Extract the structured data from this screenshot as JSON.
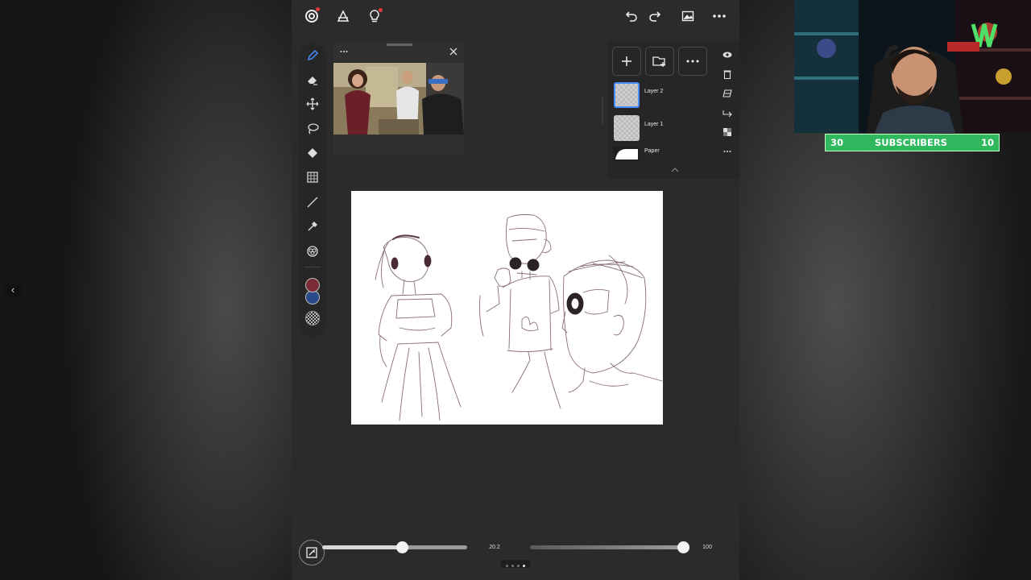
{
  "layers_panel": {
    "layers": [
      {
        "name": "Layer 2",
        "selected": true
      },
      {
        "name": "Layer 1",
        "selected": false
      },
      {
        "name": "Paper",
        "selected": false
      }
    ]
  },
  "toolbar": {
    "tools": [
      "pen-tool-icon",
      "eraser-icon",
      "move-icon",
      "lasso-icon",
      "fill-icon",
      "transform-grid-icon",
      "line-icon",
      "eyedropper-icon",
      "blend-icon"
    ],
    "primary_color": "#7a2b36",
    "secondary_color": "#2b4a8a",
    "texture_swatch": "#dcdcdc"
  },
  "bottom_bar": {
    "brush_size": "20.2",
    "brush_size_level": 0.55,
    "opacity": "100",
    "opacity_level": 1.0
  },
  "reference_window": {
    "image_description": "kitchen-photo"
  },
  "stream_overlay": {
    "subscribers_current": "30",
    "subscribers_label": "SUBSCRIBERS",
    "subscribers_goal": "10",
    "accent_color": "#2fb85e"
  }
}
